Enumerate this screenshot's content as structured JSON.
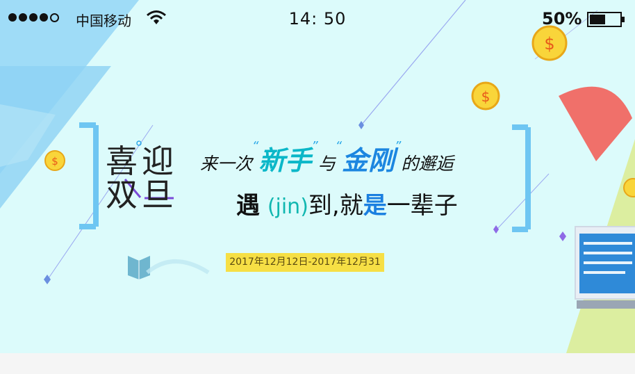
{
  "status_bar": {
    "carrier": "中国移动",
    "time": "14: 50",
    "battery": "50%"
  },
  "banner": {
    "title_row1": "喜迎",
    "title_row2": "双旦",
    "line1": {
      "prefix": "来一次",
      "quote_open": "“",
      "word1": "新手",
      "quote_close": "”",
      "connector": "与",
      "word2": "金刚",
      "suffix": "的邂逅"
    },
    "line2": {
      "part1": "遇",
      "pinyin": "(jin)",
      "part2": "到,就",
      "highlight": "是",
      "part3": "一辈子"
    },
    "date_range": "2017年12月12日-2017年12月31"
  },
  "colors": {
    "background": "#dcfbfb",
    "cyan_text": "#0bb7c8",
    "blue_text": "#1c86e0",
    "date_badge": "#f6df45",
    "bracket": "#6ec6f2"
  }
}
